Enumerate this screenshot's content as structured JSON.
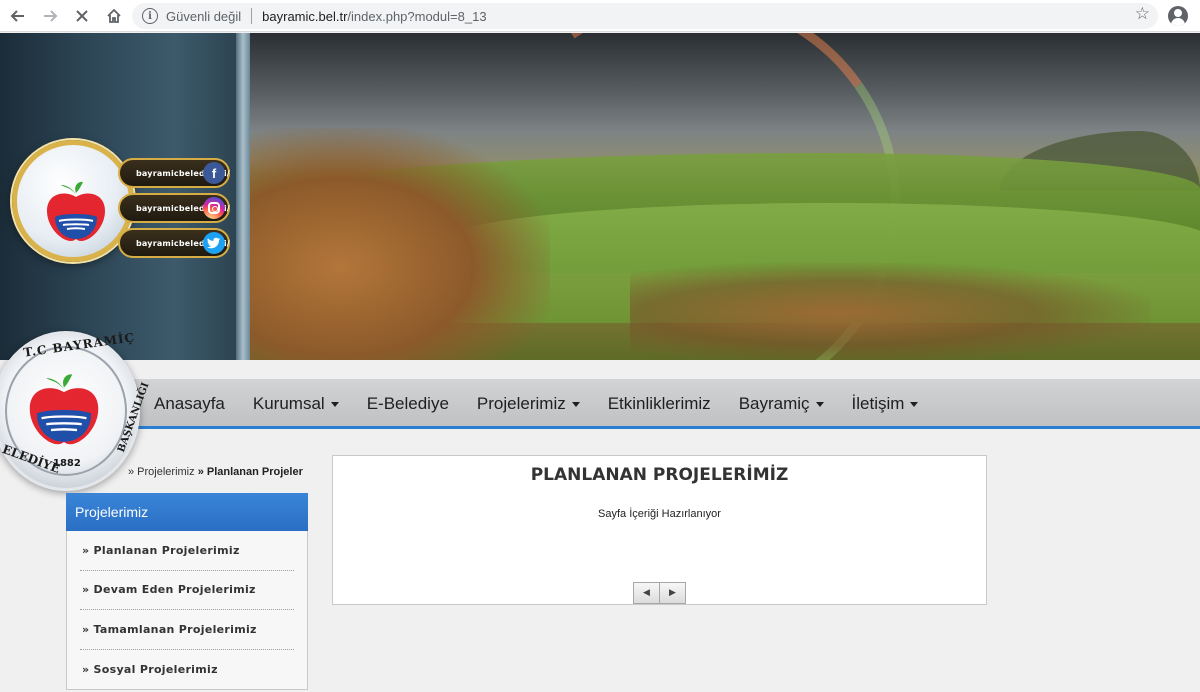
{
  "browser": {
    "back_icon": "back-arrow-icon",
    "forward_icon": "forward-arrow-icon",
    "stop_icon": "stop-loading-icon",
    "home_icon": "home-icon",
    "security_label": "Güvenli değil",
    "url_host": "bayramic.bel.tr",
    "url_path": "/index.php?modul=8_13"
  },
  "header": {
    "social": [
      {
        "handle": "bayramicbelediyesi/",
        "icon": "facebook-icon",
        "glyph": "f"
      },
      {
        "handle": "bayramicbelediyesi/",
        "icon": "instagram-icon",
        "glyph": ""
      },
      {
        "handle": "bayramicbelediyesi/",
        "icon": "twitter-icon",
        "glyph": "t"
      }
    ]
  },
  "seal": {
    "top_text": "T.C BAYRAMİÇ",
    "left_text": "ELEDİYE",
    "right_text": "BAŞKANLIĞI",
    "year": "1882"
  },
  "menu": {
    "items": [
      {
        "label": "Anasayfa",
        "dropdown": false
      },
      {
        "label": "Kurumsal",
        "dropdown": true
      },
      {
        "label": "E-Belediye",
        "dropdown": false
      },
      {
        "label": "Projelerimiz",
        "dropdown": true
      },
      {
        "label": "Etkinliklerimiz",
        "dropdown": false
      },
      {
        "label": "Bayramiç",
        "dropdown": true
      },
      {
        "label": "İletişim",
        "dropdown": true
      }
    ]
  },
  "breadcrumb": {
    "parent": "» Projelerimiz",
    "current": "» Planlanan Projeler"
  },
  "sidebar": {
    "title": "Projelerimiz",
    "items": [
      {
        "label": "» Planlanan Projelerimiz"
      },
      {
        "label": "» Devam Eden Projelerimiz"
      },
      {
        "label": "» Tamamlanan Projelerimiz"
      },
      {
        "label": "» Sosyal Projelerimiz"
      }
    ]
  },
  "content": {
    "title": "PLANLANAN PROJELERİMİZ",
    "body": "Sayfa İçeriği Hazırlanıyor",
    "prev_glyph": "◀",
    "next_glyph": "▶"
  },
  "colors": {
    "accent_blue": "#2c7fd0",
    "sidebar_header": "#2a6fc4",
    "apple_red": "#e3262f",
    "apple_leaf": "#3aa935",
    "gold_ring": "#d9b24a"
  }
}
